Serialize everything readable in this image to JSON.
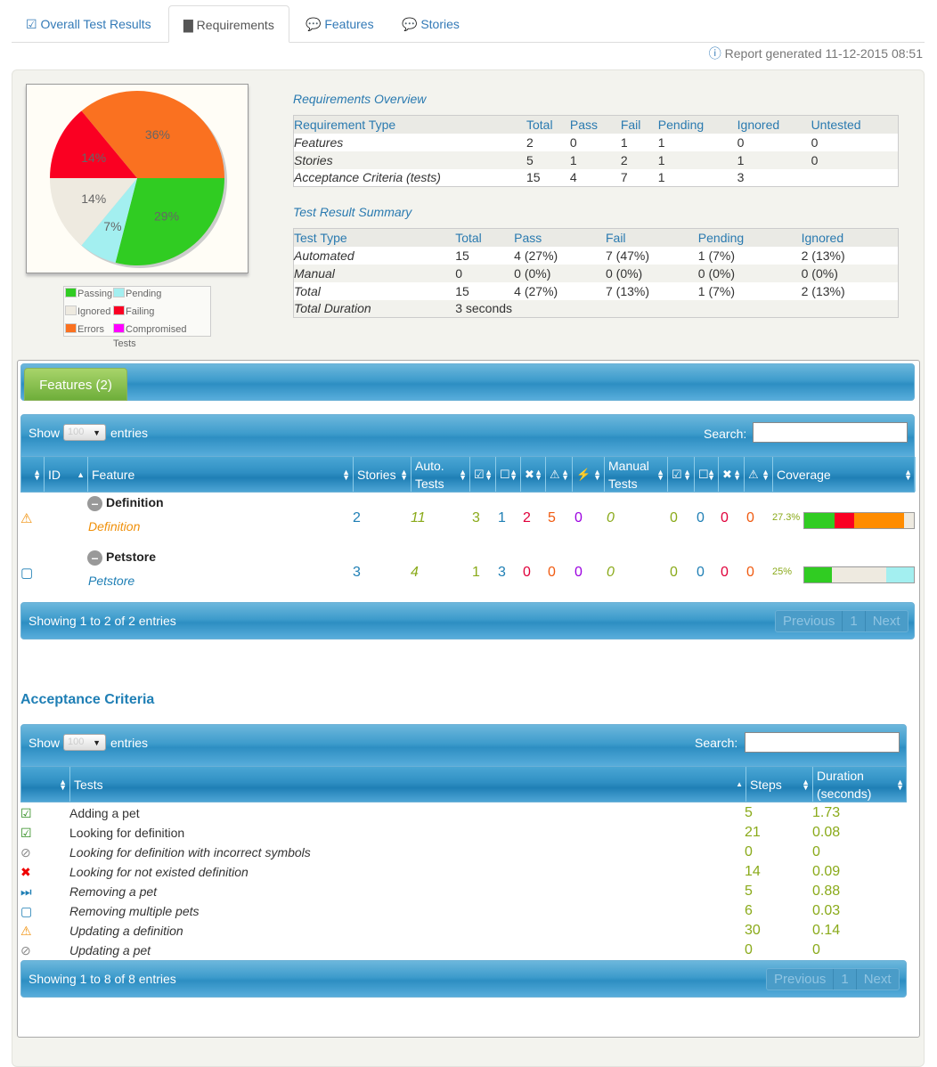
{
  "tabs": [
    {
      "label": "Overall Test Results",
      "icon": "check-square-icon"
    },
    {
      "label": "Requirements",
      "icon": "book-icon",
      "active": true
    },
    {
      "label": "Features",
      "icon": "comments-icon"
    },
    {
      "label": "Stories",
      "icon": "comments-icon"
    }
  ],
  "report_generated": "Report generated 11-12-2015 08:51",
  "chart_data": {
    "type": "pie",
    "slices": [
      {
        "label": "Passing",
        "value": 29,
        "text": "29%",
        "color": "#30cc22"
      },
      {
        "label": "Pending",
        "value": 7,
        "text": "7%",
        "color": "#a3eff0"
      },
      {
        "label": "Ignored",
        "value": 14,
        "text": "14%",
        "color": "#eeeae0"
      },
      {
        "label": "Failing",
        "value": 14,
        "text": "14%",
        "color": "#fa0022"
      },
      {
        "label": "Errors",
        "value": 36,
        "text": "36%",
        "color": "#fa7120"
      }
    ],
    "legend": [
      {
        "label": "Passing",
        "color": "#30cc22"
      },
      {
        "label": "Pending",
        "color": "#a3eff0"
      },
      {
        "label": "Ignored",
        "color": "#eeeae0"
      },
      {
        "label": "Failing",
        "color": "#fa0022"
      },
      {
        "label": "Errors",
        "color": "#fa7120"
      },
      {
        "label": "Compromised Tests",
        "color": "#ff00ff"
      }
    ]
  },
  "overview": {
    "title": "Requirements Overview",
    "headers": [
      "Requirement Type",
      "Total",
      "Pass",
      "Fail",
      "Pending",
      "Ignored",
      "Untested"
    ],
    "rows": [
      [
        "Features",
        "2",
        "0",
        "1",
        "1",
        "0",
        "0"
      ],
      [
        "Stories",
        "5",
        "1",
        "2",
        "1",
        "1",
        "0"
      ],
      [
        "Acceptance Criteria (tests)",
        "15",
        "4",
        "7",
        "1",
        "3",
        ""
      ]
    ]
  },
  "summary": {
    "title": "Test Result Summary",
    "headers": [
      "Test Type",
      "Total",
      "Pass",
      "Fail",
      "Pending",
      "Ignored"
    ],
    "rows": [
      [
        "Automated",
        "15",
        "4 (27%)",
        "7 (47%)",
        "1 (7%)",
        "2 (13%)"
      ],
      [
        "Manual",
        "0",
        "0 (0%)",
        "0 (0%)",
        "0 (0%)",
        "0 (0%)"
      ],
      [
        "Total",
        "15",
        "4 (27%)",
        "7 (13%)",
        "1 (7%)",
        "2 (13%)"
      ],
      [
        "Total Duration",
        "3 seconds",
        "",
        "",
        "",
        ""
      ]
    ]
  },
  "features": {
    "tab_label": "Features (2)",
    "show": "Show",
    "entries": "entries",
    "page_size": "100",
    "search_label": "Search:",
    "search_value": "",
    "headers": [
      "",
      "ID",
      "Feature",
      "Stories",
      "Auto. Tests",
      "",
      "",
      "",
      "",
      "",
      "Manual Tests",
      "",
      "",
      "",
      "",
      "Coverage"
    ],
    "rows": [
      {
        "status": "warning",
        "name": "Definition",
        "link": "Definition",
        "stories": "2",
        "auto": "11",
        "pass": "3",
        "pending": "1",
        "fail": "2",
        "error": "5",
        "compromised": "0",
        "manual": "0",
        "m_pass": "0",
        "m_pending": "0",
        "m_fail": "0",
        "m_error": "0",
        "coverage": "27.3%",
        "bar": [
          {
            "pct": 27.3,
            "color": "#30cc22"
          },
          {
            "pct": 18.2,
            "color": "#fa0022"
          },
          {
            "pct": 45.5,
            "color": "#ff8c00"
          },
          {
            "pct": 9,
            "color": "#eeeae0"
          }
        ]
      },
      {
        "status": "pending",
        "name": "Petstore",
        "link": "Petstore",
        "stories": "3",
        "auto": "4",
        "pass": "1",
        "pending": "3",
        "fail": "0",
        "error": "0",
        "compromised": "0",
        "manual": "0",
        "m_pass": "0",
        "m_pending": "0",
        "m_fail": "0",
        "m_error": "0",
        "coverage": "25%",
        "bar": [
          {
            "pct": 25,
            "color": "#30cc22"
          },
          {
            "pct": 50,
            "color": "#eeeae0"
          },
          {
            "pct": 25,
            "color": "#a3eff0"
          }
        ]
      }
    ],
    "footer": "Showing 1 to 2 of 2 entries",
    "prev": "Previous",
    "page": "1",
    "next": "Next"
  },
  "acceptance": {
    "title": "Acceptance Criteria",
    "show": "Show",
    "entries": "entries",
    "page_size": "100",
    "search_label": "Search:",
    "search_value": "",
    "headers": [
      "",
      "Tests",
      "Steps",
      "Duration (seconds)"
    ],
    "rows": [
      {
        "status": "success",
        "name": "Adding a pet",
        "steps": "5",
        "duration": "1.73"
      },
      {
        "status": "success",
        "name": "Looking for definition",
        "steps": "21",
        "duration": "0.08"
      },
      {
        "status": "ignored",
        "name": "Looking for definition with incorrect symbols",
        "steps": "0",
        "duration": "0"
      },
      {
        "status": "error",
        "name": "Looking for not existed definition",
        "steps": "14",
        "duration": "0.09"
      },
      {
        "status": "skipped",
        "name": "Removing a pet",
        "steps": "5",
        "duration": "0.88"
      },
      {
        "status": "pending",
        "name": "Removing multiple pets",
        "steps": "6",
        "duration": "0.03"
      },
      {
        "status": "warning",
        "name": "Updating a definition",
        "steps": "30",
        "duration": "0.14"
      },
      {
        "status": "ignored",
        "name": "Updating a pet",
        "steps": "0",
        "duration": "0"
      }
    ],
    "footer": "Showing 1 to 8 of 8 entries",
    "prev": "Previous",
    "page": "1",
    "next": "Next"
  }
}
